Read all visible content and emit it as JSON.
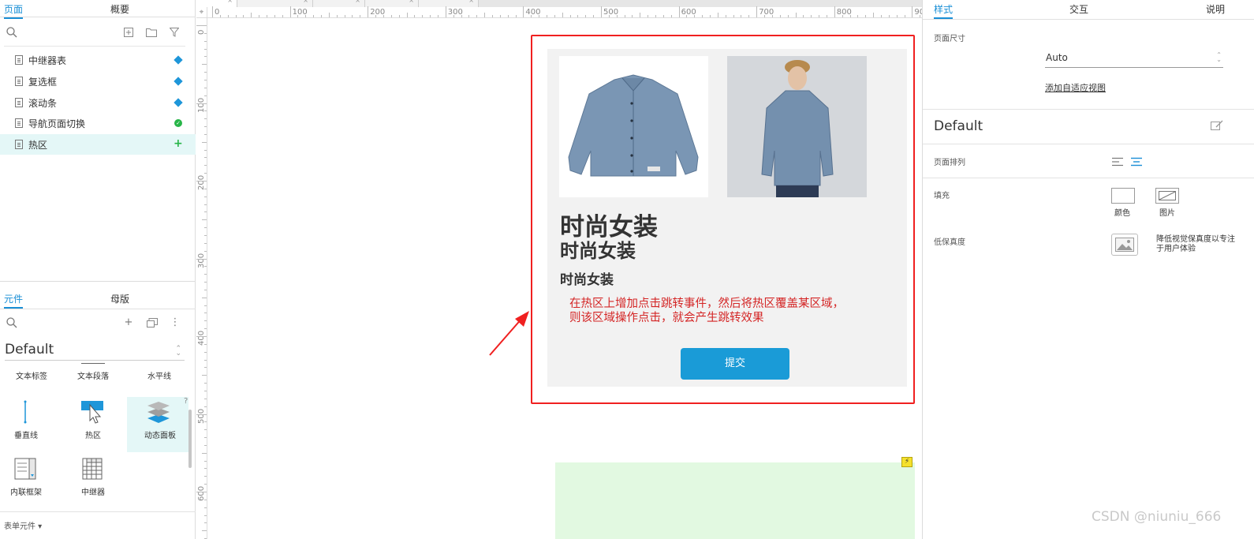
{
  "left_panel": {
    "tabs": [
      "页面",
      "概要"
    ],
    "pages": [
      {
        "label": "中继器表",
        "badge": "diamond"
      },
      {
        "label": "复选框",
        "badge": "diamond"
      },
      {
        "label": "滚动条",
        "badge": "diamond"
      },
      {
        "label": "导航页面切换",
        "badge": "check"
      },
      {
        "label": "热区",
        "badge": "plus"
      }
    ],
    "library_tabs": [
      "元件",
      "母版"
    ],
    "library_name": "Default",
    "widgets": [
      "文本标签",
      "文本段落",
      "水平线",
      "垂直线",
      "热区",
      "动态面板",
      "内联框架",
      "中继器"
    ],
    "help_mark": "?",
    "footer": "表单元件 ▾"
  },
  "canvas": {
    "ruler_h": [
      "0",
      "100",
      "200",
      "300",
      "400",
      "500",
      "600",
      "700",
      "800",
      "90"
    ],
    "ruler_v": [
      "0",
      "100",
      "200",
      "300",
      "400",
      "500",
      "600"
    ],
    "card": {
      "title_large": "时尚女装",
      "title_medium": "时尚女装",
      "title_small": "时尚女装",
      "note": "在热区上增加点击跳转事件，然后将热区覆盖某区域，则该区域操作点击，就会产生跳转效果",
      "submit_label": "提交"
    },
    "colors": {
      "accent": "#1a9bd7",
      "outline": "#f02020",
      "note": "#d42525",
      "green_panel": "#e2f9e1"
    }
  },
  "right_panel": {
    "tabs": [
      "样式",
      "交互",
      "说明"
    ],
    "page_size_label": "页面尺寸",
    "page_size_value": "Auto",
    "adaptive_link": "添加自适应视图",
    "style_name": "Default",
    "arrange_label": "页面排列",
    "fill_label": "填充",
    "fill_color": "颜色",
    "fill_image": "图片",
    "low_fidelity_label": "低保真度",
    "low_fidelity_desc": "降低视觉保真度以专注于用户体验"
  },
  "watermark": "CSDN @niuniu_666"
}
